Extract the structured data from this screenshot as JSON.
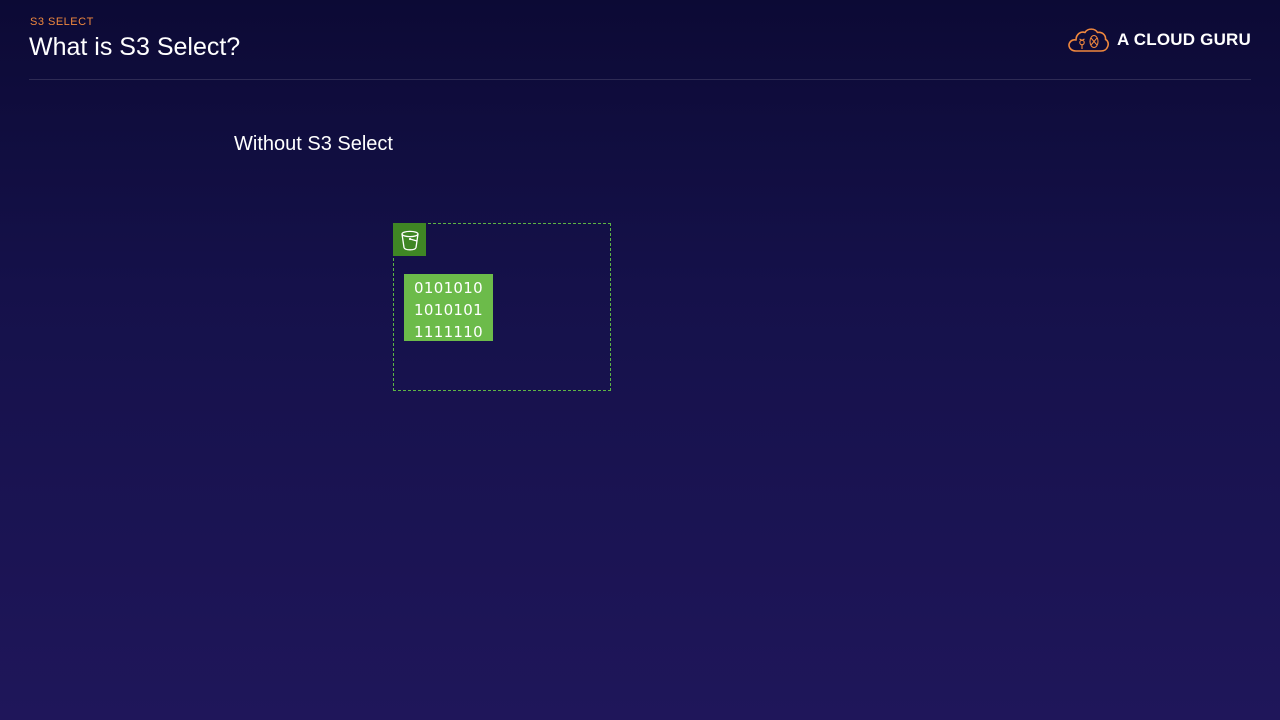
{
  "header": {
    "eyebrow": "S3 SELECT",
    "title": "What is S3 Select?"
  },
  "brand": {
    "name": "A CLOUD GURU",
    "icon": "cloud-logo-icon",
    "accent_color": "#f0883e"
  },
  "content": {
    "heading": "Without S3 Select",
    "bucket": {
      "icon": "s3-bucket-icon",
      "border_color": "#5db544",
      "badge_color": "#3f8624"
    },
    "data_object": {
      "fill_color": "#6cbb4a",
      "lines": [
        "0101010",
        "1010101",
        "1111110"
      ]
    }
  }
}
